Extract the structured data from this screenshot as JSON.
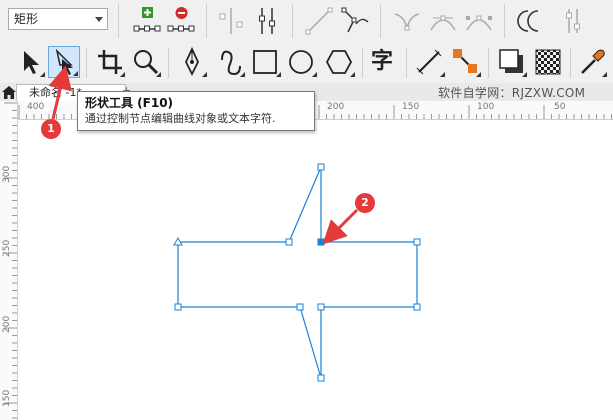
{
  "property_bar": {
    "object_type_value": "矩形"
  },
  "toolbox": {
    "tools": [
      {
        "name": "pick-tool",
        "active": false
      },
      {
        "name": "shape-tool",
        "active": true
      },
      {
        "name": "crop-tool",
        "active": false
      },
      {
        "name": "zoom-tool",
        "active": false
      },
      {
        "name": "freehand-tool",
        "active": false
      },
      {
        "name": "artistic-media-tool",
        "active": false
      },
      {
        "name": "rectangle-tool",
        "active": false
      },
      {
        "name": "ellipse-tool",
        "active": false
      },
      {
        "name": "polygon-tool",
        "active": false
      },
      {
        "name": "text-tool",
        "active": false
      },
      {
        "name": "parallel-dimension-tool",
        "active": false
      },
      {
        "name": "connector-tool",
        "active": false
      },
      {
        "name": "drop-shadow-tool",
        "active": false
      },
      {
        "name": "transparency-tool",
        "active": false
      },
      {
        "name": "eyedropper-tool",
        "active": false
      }
    ],
    "text_tool_glyph": "字"
  },
  "tabs": {
    "document_tab": "未命名 -1*",
    "add_tab": "+"
  },
  "watermark": "软件自学网：RJZXW.COM",
  "rulers": {
    "horizontal": [
      "400",
      "200",
      "150",
      "100",
      "50"
    ],
    "vertical": [
      "300",
      "250",
      "200",
      "150"
    ]
  },
  "tooltip": {
    "title": "形状工具 (F10)",
    "description": "通过控制节点编辑曲线对象或文本字符."
  },
  "annotations": [
    "1",
    "2"
  ],
  "colors": {
    "path_stroke": "#1a82d8",
    "annotation": "#e43a3a",
    "toolbar_bg": "#f0f0f0",
    "active_tool_bg": "#cfe6fb"
  }
}
